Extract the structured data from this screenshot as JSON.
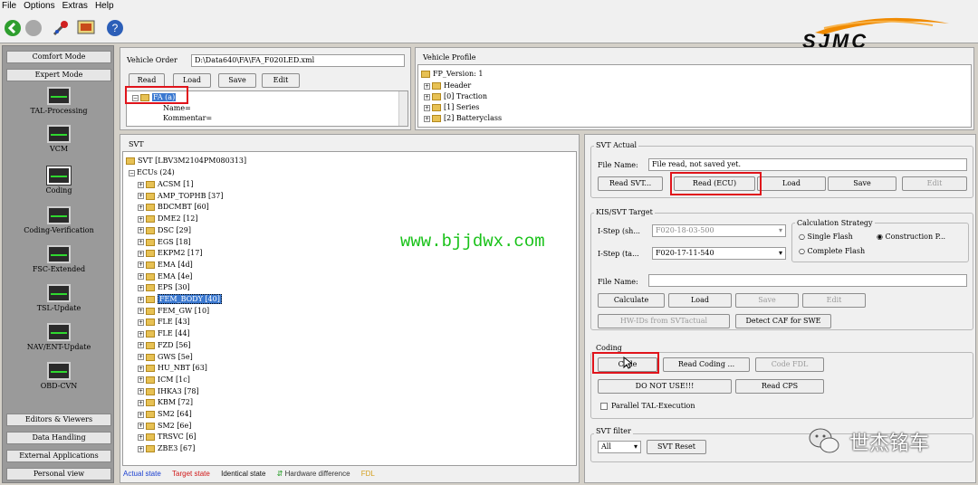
{
  "menu": [
    "File",
    "Options",
    "Extras",
    "Help"
  ],
  "icons": [
    "green-arrow-icon",
    "gray-circle-icon",
    "wrench-icon",
    "monitor-icon",
    "help-icon"
  ],
  "sidebar": {
    "top_buttons": [
      "Comfort Mode",
      "Expert Mode"
    ],
    "modules": [
      "TAL-Processing",
      "VCM",
      "Coding",
      "Coding-Verification",
      "FSC-Extended",
      "TSL-Update",
      "NAV/ENT-Update",
      "OBD-CVN"
    ],
    "bottom_buttons": [
      "Editors & Viewers",
      "Data Handling",
      "External Applications",
      "Personal view"
    ]
  },
  "vehicle_order": {
    "label": "Vehicle Order",
    "path": "D:\\Data640\\FA\\FA_F020LED.xml",
    "buttons": [
      "Read",
      "Load",
      "Save",
      "Edit"
    ],
    "tree": [
      "FA (a)",
      "Name=",
      "Kommentar="
    ]
  },
  "vehicle_profile": {
    "label": "Vehicle Profile",
    "items": [
      "FP_Version: 1",
      "Header",
      "[0] Traction",
      "[1] Series",
      "[2] Batteryclass"
    ]
  },
  "svt": {
    "label": "SVT",
    "root": "SVT [LBV3M2104PM080313]",
    "ecus_label": "ECUs (24)",
    "ecus": [
      "ACSM [1]",
      "AMP_TOPHB [37]",
      "BDCMBT [60]",
      "DME2 [12]",
      "DSC [29]",
      "EGS [18]",
      "EKPM2 [17]",
      "EMA [4d]",
      "EMA [4e]",
      "EPS [30]",
      "FEM_BODY [40]",
      "FEM_GW [10]",
      "FLE [43]",
      "FLE [44]",
      "FZD [56]",
      "GWS [5e]",
      "HU_NBT [63]",
      "ICM [1c]",
      "IHKA3 [78]",
      "KBM [72]",
      "SM2 [64]",
      "SM2 [6e]",
      "TRSVC [6]",
      "ZBE3 [67]"
    ],
    "selected_index": 10
  },
  "legend": {
    "actual": "Actual state",
    "target": "Target state",
    "identical": "Identical state",
    "hardware": "Hardware difference",
    "fdl": "FDL"
  },
  "svt_actual": {
    "label": "SVT Actual",
    "file_label": "File Name:",
    "file_value": "File read, not saved yet.",
    "buttons": [
      "Read SVT...",
      "Read (ECU)",
      "Load",
      "Save",
      "Edit"
    ]
  },
  "kis": {
    "label": "KIS/SVT Target",
    "istep_sh_label": "I-Step (sh...",
    "istep_sh_value": "F020-18-03-500",
    "istep_ta_label": "I-Step (ta...",
    "istep_ta_value": "F020-17-11-540",
    "strategy_label": "Calculation Strategy",
    "single_flash": "Single Flash",
    "construction": "Construction P...",
    "complete_flash": "Complete Flash",
    "file_label": "File Name:",
    "buttons": [
      "Calculate",
      "Load",
      "Save",
      "Edit"
    ],
    "hw_button": "HW-IDs from SVTactual",
    "detect_button": "Detect CAF for SWE"
  },
  "coding": {
    "label": "Coding",
    "code_button": "Code",
    "read_coding": "Read Coding ...",
    "code_fdl": "Code FDL",
    "do_not_use": "DO NOT USE!!!",
    "read_cps": "Read CPS",
    "parallel": "Parallel TAL-Execution"
  },
  "svt_filter": {
    "label": "SVT filter",
    "value": "All",
    "reset": "SVT Reset"
  },
  "watermark": "www.bjjdwx.com",
  "logo_text": "SJMC",
  "wechat_text": "世杰铭车",
  "colors": {
    "watermark": "#19c219",
    "red_highlight": "#e0141b",
    "logo_orange": "#f08a00",
    "selected_blue": "#3a78d0"
  }
}
